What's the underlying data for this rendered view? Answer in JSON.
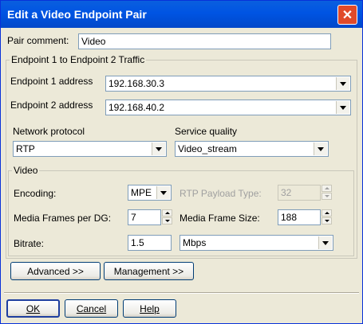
{
  "window": {
    "title": "Edit a Video Endpoint Pair",
    "close_glyph": "✕"
  },
  "pair_comment": {
    "label": "Pair comment:",
    "value": "Video"
  },
  "traffic_group": {
    "label": "Endpoint 1 to Endpoint 2 Traffic",
    "endpoint1": {
      "label": "Endpoint 1 address",
      "value": "192.168.30.3"
    },
    "endpoint2": {
      "label": "Endpoint 2 address",
      "value": "192.168.40.2"
    },
    "network_protocol": {
      "label": "Network protocol",
      "value": "RTP"
    },
    "service_quality": {
      "label": "Service quality",
      "value": "Video_stream"
    }
  },
  "video_group": {
    "label": "Video",
    "encoding": {
      "label": "Encoding:",
      "value": "MPE"
    },
    "rtp_payload": {
      "label": "RTP Payload Type:",
      "value": "32"
    },
    "frames_per_dg": {
      "label": "Media Frames per DG:",
      "value": "7"
    },
    "frame_size": {
      "label": "Media Frame Size:",
      "value": "188"
    },
    "bitrate": {
      "label": "Bitrate:",
      "value": "1.5",
      "unit": "Mbps"
    }
  },
  "buttons": {
    "advanced": "Advanced >>",
    "management": "Management >>",
    "ok": "OK",
    "cancel": "Cancel",
    "help": "Help"
  }
}
